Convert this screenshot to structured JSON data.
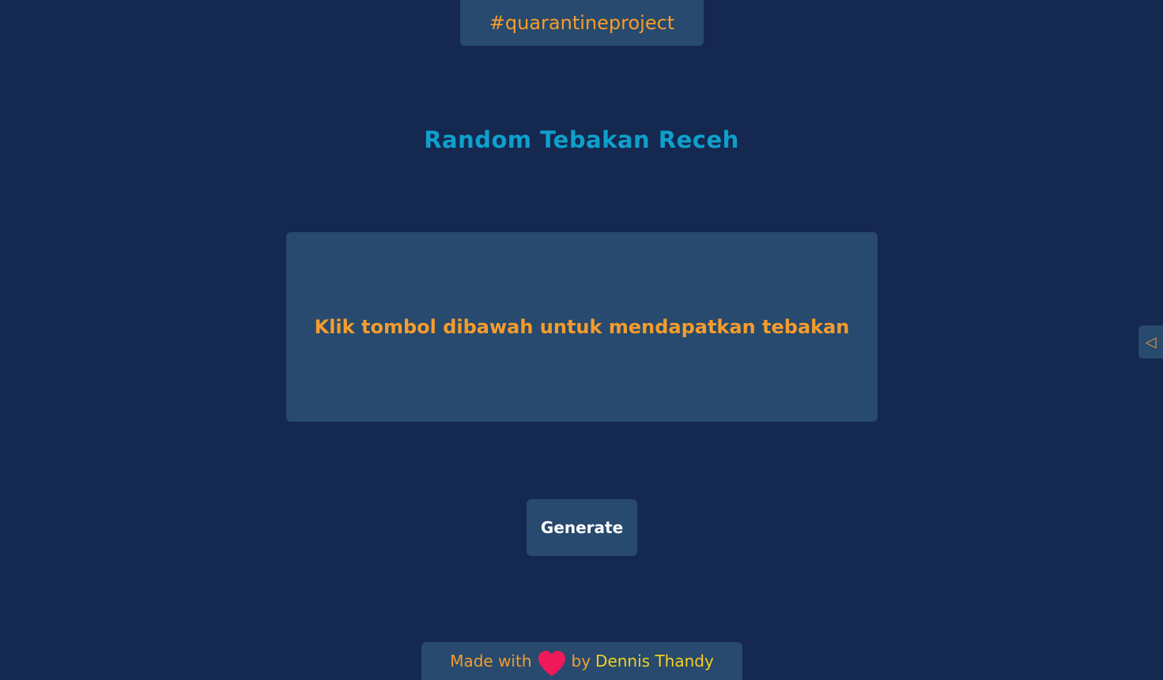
{
  "header": {
    "tag": "#quarantineproject"
  },
  "main": {
    "title": "Random Tebakan Receh",
    "joke_text": "Klik tombol dibawah untuk mendapatkan tebakan",
    "generate_label": "Generate"
  },
  "side_toggle": {
    "icon": "◁"
  },
  "footer": {
    "made_with": "Made with",
    "by": "by",
    "author": "Dennis Thandy"
  },
  "colors": {
    "background": "#152850",
    "card": "#274a6e",
    "accent_orange": "#f59c2c",
    "title_blue": "#0ea0cc",
    "heart": "#f0195a",
    "author_yellow": "#f5d020"
  }
}
